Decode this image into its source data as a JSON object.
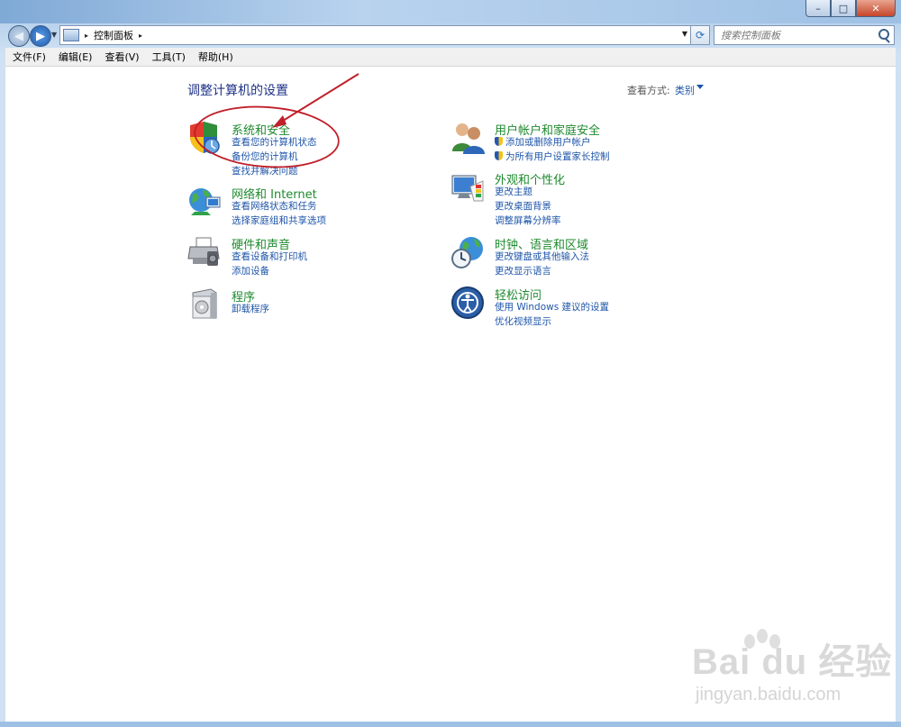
{
  "window": {
    "min_label": "–",
    "max_label": "□",
    "close_label": "✕"
  },
  "address": {
    "crumb_root_sep": "▸",
    "crumb": "控制面板",
    "crumb_sep": "▸",
    "search_placeholder": "搜索控制面板"
  },
  "menu": [
    "文件(F)",
    "编辑(E)",
    "查看(V)",
    "工具(T)",
    "帮助(H)"
  ],
  "page": {
    "heading": "调整计算机的设置",
    "view_by_label": "查看方式:",
    "view_by_value": "类别"
  },
  "categories": [
    {
      "title": "系统和安全",
      "icon": "security-shield-icon",
      "links": [
        "查看您的计算机状态",
        "备份您的计算机",
        "查找并解决问题"
      ]
    },
    {
      "title": "网络和 Internet",
      "icon": "network-globe-icon",
      "links": [
        "查看网络状态和任务",
        "选择家庭组和共享选项"
      ]
    },
    {
      "title": "硬件和声音",
      "icon": "printer-icon",
      "links": [
        "查看设备和打印机",
        "添加设备"
      ]
    },
    {
      "title": "程序",
      "icon": "programs-box-icon",
      "links": [
        "卸载程序"
      ]
    },
    {
      "title": "用户帐户和家庭安全",
      "icon": "users-icon",
      "links": [
        "添加或删除用户帐户",
        "为所有用户设置家长控制"
      ]
    },
    {
      "title": "外观和个性化",
      "icon": "monitor-palette-icon",
      "links": [
        "更改主题",
        "更改桌面背景",
        "调整屏幕分辨率"
      ]
    },
    {
      "title": "时钟、语言和区域",
      "icon": "clock-globe-icon",
      "links": [
        "更改键盘或其他输入法",
        "更改显示语言"
      ]
    },
    {
      "title": "轻松访问",
      "icon": "ease-of-access-icon",
      "links": [
        "使用 Windows 建议的设置",
        "优化视频显示"
      ]
    }
  ],
  "watermark": {
    "brand": "Bai du 经验",
    "url": "jingyan.baidu.com"
  },
  "colors": {
    "heading": "#1e3287",
    "category_title": "#1e8a2e",
    "link": "#1e55a8",
    "annotation": "#c0202a"
  }
}
